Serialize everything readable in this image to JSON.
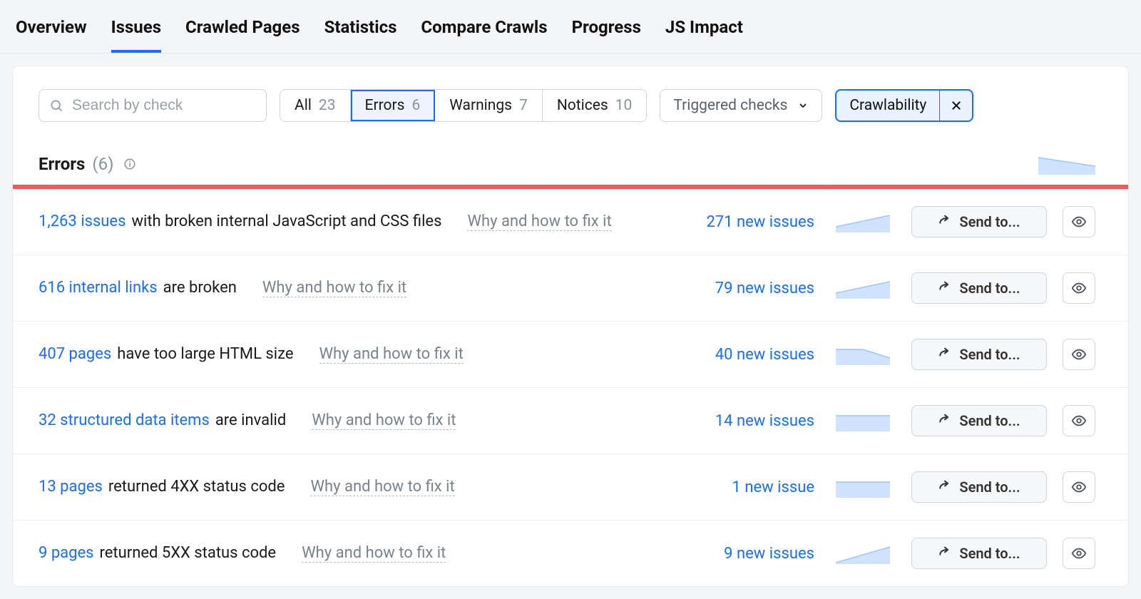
{
  "nav": {
    "tabs": [
      "Overview",
      "Issues",
      "Crawled Pages",
      "Statistics",
      "Compare Crawls",
      "Progress",
      "JS Impact"
    ],
    "active_index": 1
  },
  "toolbar": {
    "search_placeholder": "Search by check",
    "filters": [
      {
        "label": "All",
        "count": "23"
      },
      {
        "label": "Errors",
        "count": "6"
      },
      {
        "label": "Warnings",
        "count": "7"
      },
      {
        "label": "Notices",
        "count": "10"
      }
    ],
    "filters_active_index": 1,
    "dropdown_label": "Triggered checks",
    "chip_label": "Crawlability"
  },
  "section": {
    "title": "Errors",
    "count_display": "(6)"
  },
  "why_label": "Why and how to fix it",
  "send_to_label": "Send to...",
  "rows": [
    {
      "link_text": "1,263 issues",
      "rest_text": "with broken internal JavaScript and CSS files",
      "new_issues": "271 new issues",
      "spark_shape": "rise"
    },
    {
      "link_text": "616 internal links",
      "rest_text": "are broken",
      "new_issues": "79 new issues",
      "spark_shape": "rise"
    },
    {
      "link_text": "407 pages",
      "rest_text": "have too large HTML size",
      "new_issues": "40 new issues",
      "spark_shape": "dip"
    },
    {
      "link_text": "32 structured data items",
      "rest_text": "are invalid",
      "new_issues": "14 new issues",
      "spark_shape": "flat"
    },
    {
      "link_text": "13 pages",
      "rest_text": "returned 4XX status code",
      "new_issues": "1 new issue",
      "spark_shape": "flat"
    },
    {
      "link_text": "9 pages",
      "rest_text": "returned 5XX status code",
      "new_issues": "9 new issues",
      "spark_shape": "spike"
    }
  ],
  "colors": {
    "link": "#1a6dff",
    "spark_fill": "#cfe3ff",
    "spark_stroke": "#9fc4f7",
    "error_bar": "#f05a5a"
  }
}
